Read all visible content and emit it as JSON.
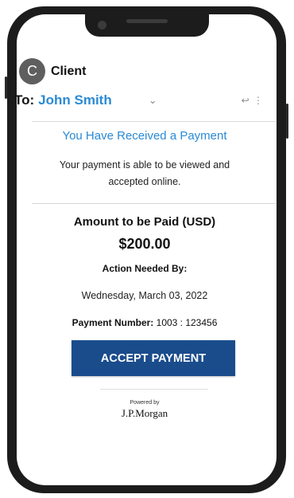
{
  "email": {
    "sender_initial": "C",
    "sender_name": "Client",
    "to_label": "To:",
    "to_name": "John Smith",
    "chevron_glyph": "⌄",
    "reply_glyph": "↩ ⋮"
  },
  "content": {
    "headline": "You Have Received a Payment",
    "subtext_line1": "Your payment is able to be viewed and",
    "subtext_line2": "accepted online.",
    "amount_label": "Amount to be Paid (USD)",
    "amount": "$200.00",
    "action_label": "Action Needed By:",
    "due_date": "Wednesday, March 03, 2022",
    "payment_number_label": "Payment Number:",
    "payment_number": "1003 : 123456",
    "accept_button": "ACCEPT PAYMENT",
    "powered_by": "Powered by",
    "brand": "J.P.Morgan"
  },
  "colors": {
    "link_blue": "#2a8ad4",
    "button_blue": "#1a4c8c",
    "phone_frame": "#1c1c1c"
  }
}
